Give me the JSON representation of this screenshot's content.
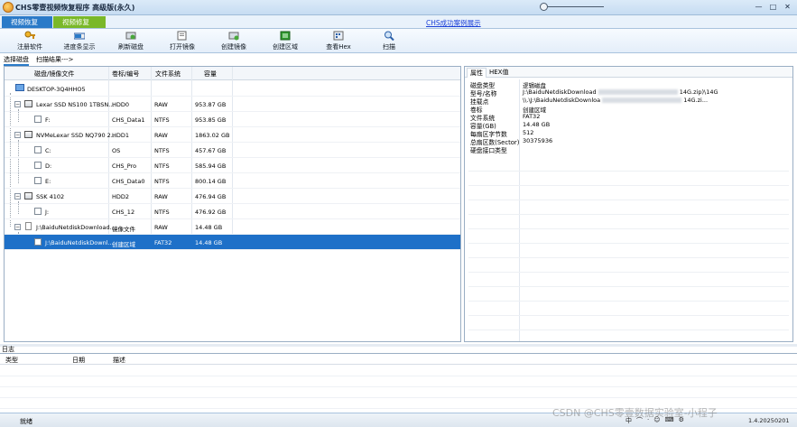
{
  "window": {
    "title": "CHS零壹视频恢复程序 高级版(永久)",
    "controls": [
      "—",
      "□",
      "✕"
    ]
  },
  "tabs": [
    "视频恢复",
    "视频修复"
  ],
  "top_link": "CHS成功案例展示",
  "toolbar": [
    {
      "label": "注册软件",
      "icon": "key-icon"
    },
    {
      "label": "进度条显示",
      "icon": "progress-icon"
    },
    {
      "label": "刷新磁盘",
      "icon": "refresh-disk-icon"
    },
    {
      "label": "打开镜像",
      "icon": "open-image-icon"
    },
    {
      "label": "创建镜像",
      "icon": "create-image-icon"
    },
    {
      "label": "创建区域",
      "icon": "create-region-icon"
    },
    {
      "label": "查看Hex",
      "icon": "hex-view-icon"
    },
    {
      "label": "扫描",
      "icon": "scan-icon"
    }
  ],
  "subtabs": [
    "选择磁盘",
    "扫描结果--->"
  ],
  "disk_table": {
    "columns": [
      "磁盘/镜像文件",
      "卷标/编号",
      "文件系统",
      "容量"
    ],
    "rows": [
      {
        "name": "DESKTOP-3Q4HHO5",
        "label": "",
        "fs": "",
        "size": "",
        "level": 0,
        "type": "pc"
      },
      {
        "name": "Lexar SSD NS100 1TBSN...",
        "label": "HDD0",
        "fs": "RAW",
        "size": "953.87 GB",
        "level": 1,
        "type": "disk"
      },
      {
        "name": "F:",
        "label": "CHS_Data1",
        "fs": "NTFS",
        "size": "953.85 GB",
        "level": 2,
        "type": "vol"
      },
      {
        "name": "NVMeLexar SSD NQ790 2...",
        "label": "HDD1",
        "fs": "RAW",
        "size": "1863.02 GB",
        "level": 1,
        "type": "disk"
      },
      {
        "name": "C:",
        "label": "OS",
        "fs": "NTFS",
        "size": "457.67 GB",
        "level": 2,
        "type": "vol"
      },
      {
        "name": "D:",
        "label": "CHS_Pro",
        "fs": "NTFS",
        "size": "585.94 GB",
        "level": 2,
        "type": "vol"
      },
      {
        "name": "E:",
        "label": "CHS_Data0",
        "fs": "NTFS",
        "size": "800.14 GB",
        "level": 2,
        "type": "vol"
      },
      {
        "name": "SSK          4102",
        "label": "HDD2",
        "fs": "RAW",
        "size": "476.94 GB",
        "level": 1,
        "type": "disk"
      },
      {
        "name": "J:",
        "label": "CHS_12",
        "fs": "NTFS",
        "size": "476.92 GB",
        "level": 2,
        "type": "vol"
      },
      {
        "name": "J:\\BaiduNetdiskDownload...",
        "label": "镜像文件",
        "fs": "RAW",
        "size": "14.48 GB",
        "level": 1,
        "type": "file"
      },
      {
        "name": "J:\\BaiduNetdiskDownl...",
        "label": "创建区域",
        "fs": "FAT32",
        "size": "14.48 GB",
        "level": 2,
        "type": "vol",
        "selected": true
      }
    ]
  },
  "right_tabs": [
    "属性",
    "HEX值"
  ],
  "properties": [
    {
      "k": "磁盘类型",
      "v": "逻辑磁盘"
    },
    {
      "k": "型号/名称",
      "v": "J:\\BaiduNetdiskDownload",
      "tail": "14G.zip)\\14G"
    },
    {
      "k": "挂载点",
      "v": "\\\\.\\J:\\BaiduNetdiskDownloa",
      "tail": "14G.zi..."
    },
    {
      "k": "卷标",
      "v": "创建区域"
    },
    {
      "k": "文件系统",
      "v": "FAT32"
    },
    {
      "k": "容量(GB)",
      "v": "14.48 GB"
    },
    {
      "k": "每扇区字节数",
      "v": "512"
    },
    {
      "k": "总扇区数(Sector)",
      "v": "30375936"
    },
    {
      "k": "硬盘接口类型",
      "v": ""
    }
  ],
  "log": {
    "title": "日志",
    "columns": [
      "类型",
      "日期",
      "描述"
    ]
  },
  "status": {
    "text": "就绪",
    "version": "1.4.20250201",
    "ime": [
      "中",
      "⌒",
      "·",
      "☺",
      "⌨",
      "⚙"
    ]
  },
  "watermark": "CSDN @CHS零壹数据实验室-小程子"
}
